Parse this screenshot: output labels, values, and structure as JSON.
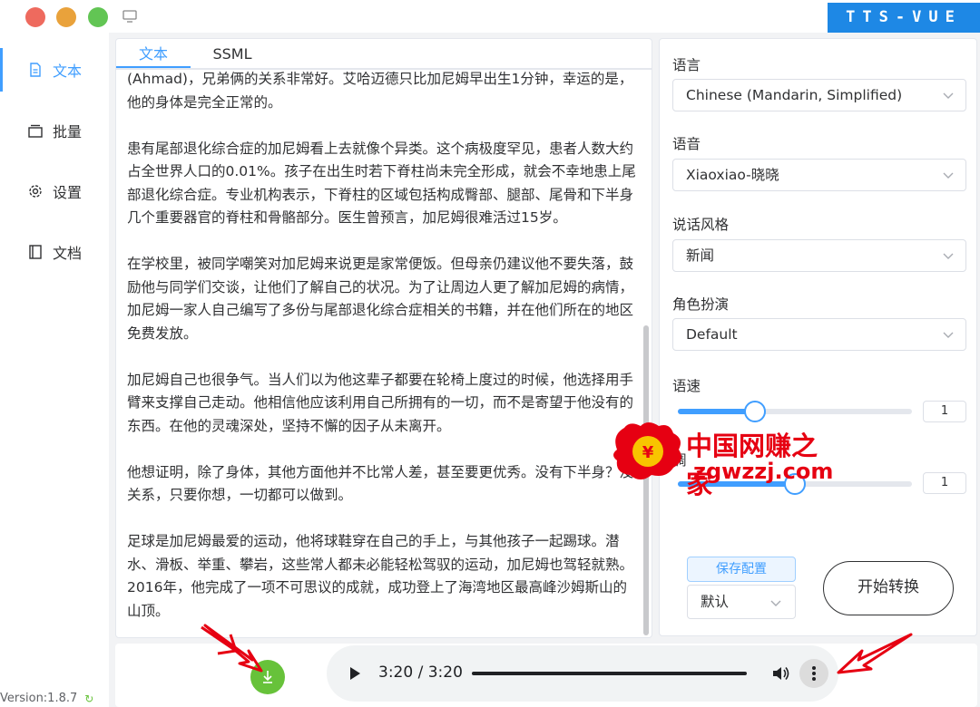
{
  "app": {
    "brand": "TTS-VUE"
  },
  "sidebar": {
    "items": [
      {
        "label": "文本",
        "icon": "document-icon",
        "active": true
      },
      {
        "label": "批量",
        "icon": "batch-icon"
      },
      {
        "label": "设置",
        "icon": "gear-icon"
      },
      {
        "label": "文档",
        "icon": "book-icon"
      }
    ],
    "version": "Version:1.8.7"
  },
  "editor": {
    "tabs": [
      {
        "label": "文本"
      },
      {
        "label": "SSML"
      }
    ],
    "paragraphs": [
      "(Ahmad)，兄弟俩的关系非常好。艾哈迈德只比加尼姆早出生1分钟，幸运的是，他的身体是完全正常的。",
      "患有尾部退化综合症的加尼姆看上去就像个异类。这个病极度罕见，患者人数大约占全世界人口的0.01%。孩子在出生时若下脊柱尚未完全形成，就会不幸地患上尾部退化综合症。专业机构表示，下脊柱的区域包括构成臀部、腿部、尾骨和下半身几个重要器官的脊柱和骨骼部分。医生曾预言，加尼姆很难活过15岁。",
      "在学校里，被同学嘲笑对加尼姆来说更是家常便饭。但母亲仍建议他不要失落，鼓励他与同学们交谈，让他们了解自己的状况。为了让周边人更了解加尼姆的病情，加尼姆一家人自己编写了多份与尾部退化综合症相关的书籍，并在他们所在的地区免费发放。",
      "加尼姆自己也很争气。当人们以为他这辈子都要在轮椅上度过的时候，他选择用手臂来支撑自己走动。他相信他应该利用自己所拥有的一切，而不是寄望于他没有的东西。在他的灵魂深处，坚持不懈的因子从未离开。",
      "他想证明，除了身体，其他方面他并不比常人差，甚至要更优秀。没有下半身？没关系，只要你想，一切都可以做到。",
      "足球是加尼姆最爱的运动，他将球鞋穿在自己的手上，与其他孩子一起踢球。潜水、滑板、举重、攀岩，这些常人都未必能轻松驾驭的运动，加尼姆也驾轻就熟。2016年，他完成了一项不可思议的成就，成功登上了海湾地区最高峰沙姆斯山的山顶。"
    ]
  },
  "settings": {
    "language_label": "语言",
    "language_value": "Chinese (Mandarin, Simplified)",
    "voice_label": "语音",
    "voice_value": "Xiaoxiao-晓晓",
    "style_label": "说话风格",
    "style_value": "新闻",
    "role_label": "角色扮演",
    "role_value": "Default",
    "speed_label": "语速",
    "speed_value": "1",
    "speed_fraction": 0.33,
    "pitch_label": "调",
    "pitch_value": "1",
    "pitch_fraction": 0.5,
    "save_config_label": "保存配置",
    "preset_value": "默认",
    "convert_label": "开始转换"
  },
  "player": {
    "time": "3:20 / 3:20",
    "progress": 1.0
  },
  "watermark": {
    "title": "中国网赚之家",
    "url": "zgwzzj.com"
  },
  "colors": {
    "accent": "#409eff",
    "download": "#67c23a",
    "brand_bg": "#1e88e5",
    "watermark": "#e60012"
  }
}
